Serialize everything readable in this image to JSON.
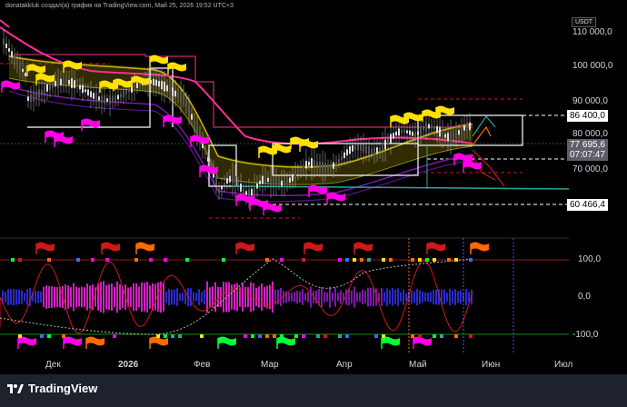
{
  "header": {
    "caption": "donatakkluk создал(а) график на TradingView.com, Май 25, 2026 19:52 UTC+3"
  },
  "price_axis": {
    "currency": "USDT",
    "ticks": [
      "110 000,0",
      "100 000,0",
      "90 000,0",
      "80 000,0",
      "70 000,0"
    ],
    "level_upper": "86 400,0",
    "current_price": "77 695,6",
    "countdown": "07:07:47",
    "level_lower": "60 466,4"
  },
  "indicator_axis": {
    "ticks": [
      "100,0",
      "0,0",
      "-100,0"
    ]
  },
  "time_axis": {
    "labels": [
      {
        "text": "Дек",
        "bold": false
      },
      {
        "text": "2026",
        "bold": true
      },
      {
        "text": "Фев",
        "bold": false
      },
      {
        "text": "Мар",
        "bold": false
      },
      {
        "text": "Апр",
        "bold": false
      },
      {
        "text": "Май",
        "bold": false
      },
      {
        "text": "Июн",
        "bold": false
      },
      {
        "text": "Июл",
        "bold": false
      }
    ]
  },
  "colors": {
    "background": "#000000",
    "candles": "#c8c8c8",
    "ma_pink": "#ff2d95",
    "band_yellow": "#c8b400",
    "flag_yellow": "#ffe100",
    "flag_magenta": "#ff00e6",
    "osc_red": "#d01818",
    "hist_magenta": "#d020c0",
    "hist_blue": "#2a2ad0"
  },
  "footer": {
    "brand": "TradingView"
  }
}
